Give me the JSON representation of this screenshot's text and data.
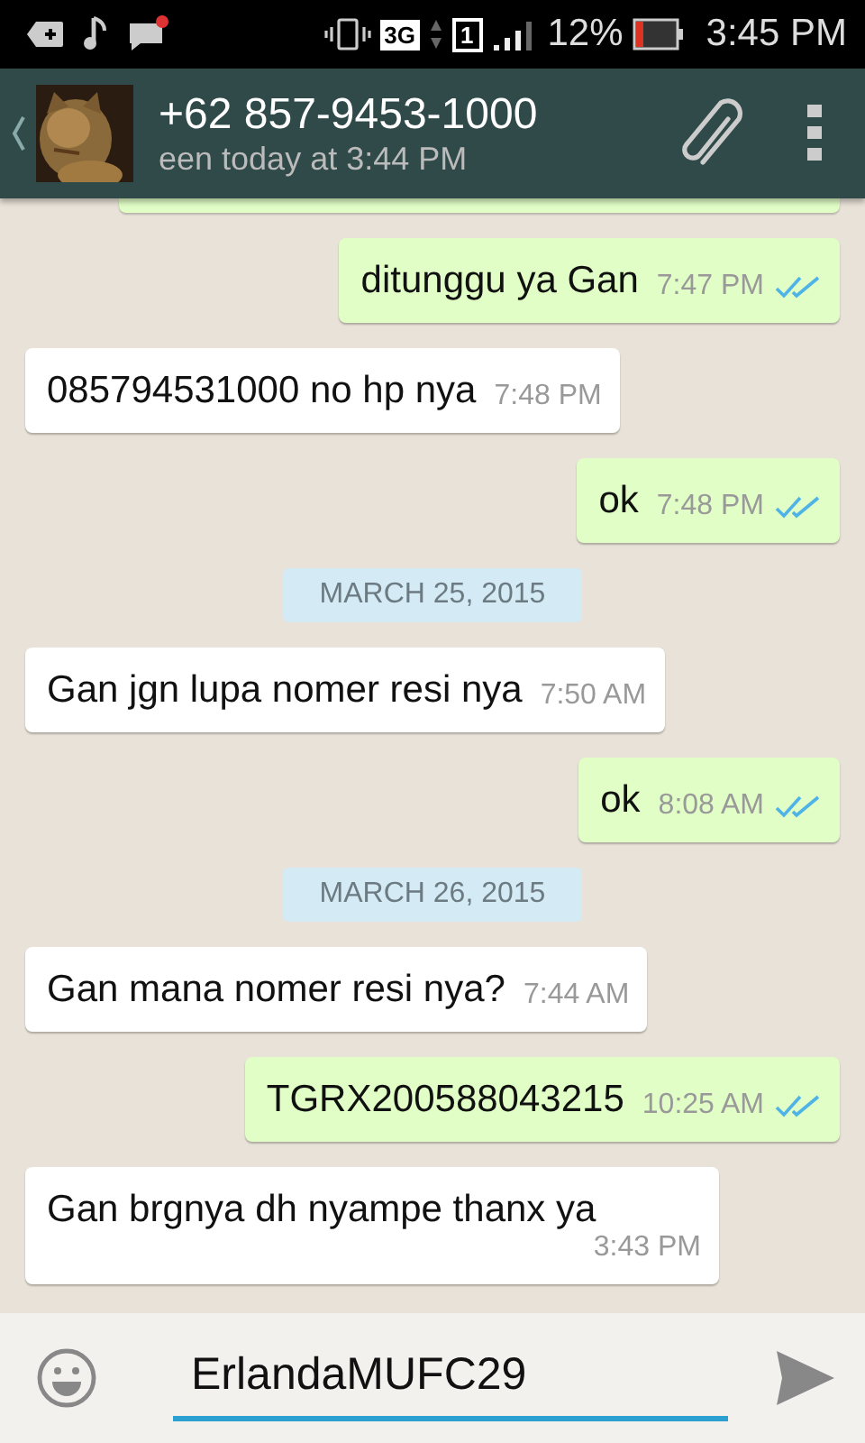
{
  "status_bar": {
    "network": "3G",
    "sim": "1",
    "battery": "12%",
    "time": "3:45 PM"
  },
  "header": {
    "title": "+62 857-9453-1000",
    "subtitle": "een today at 3:44 PM"
  },
  "messages": [
    {
      "kind": "out",
      "text": "ditunggu ya Gan",
      "time": "7:47 PM",
      "read": true
    },
    {
      "kind": "in",
      "text": "085794531000 no hp nya",
      "time": "7:48 PM"
    },
    {
      "kind": "out",
      "text": "ok",
      "time": "7:48 PM",
      "read": true
    },
    {
      "kind": "date",
      "text": "MARCH 25, 2015"
    },
    {
      "kind": "in",
      "text": "Gan jgn lupa nomer resi nya",
      "time": "7:50 AM"
    },
    {
      "kind": "out",
      "text": "ok",
      "time": "8:08 AM",
      "read": true
    },
    {
      "kind": "date",
      "text": "MARCH 26, 2015"
    },
    {
      "kind": "in",
      "text": "Gan mana nomer resi nya?",
      "time": "7:44 AM"
    },
    {
      "kind": "out",
      "text": "TGRX200588043215",
      "time": "10:25 AM",
      "read": true
    },
    {
      "kind": "in",
      "text": "Gan brgnya dh nyampe thanx ya",
      "time": "3:43 PM"
    }
  ],
  "composer": {
    "value": "ErlandaMUFC29"
  }
}
